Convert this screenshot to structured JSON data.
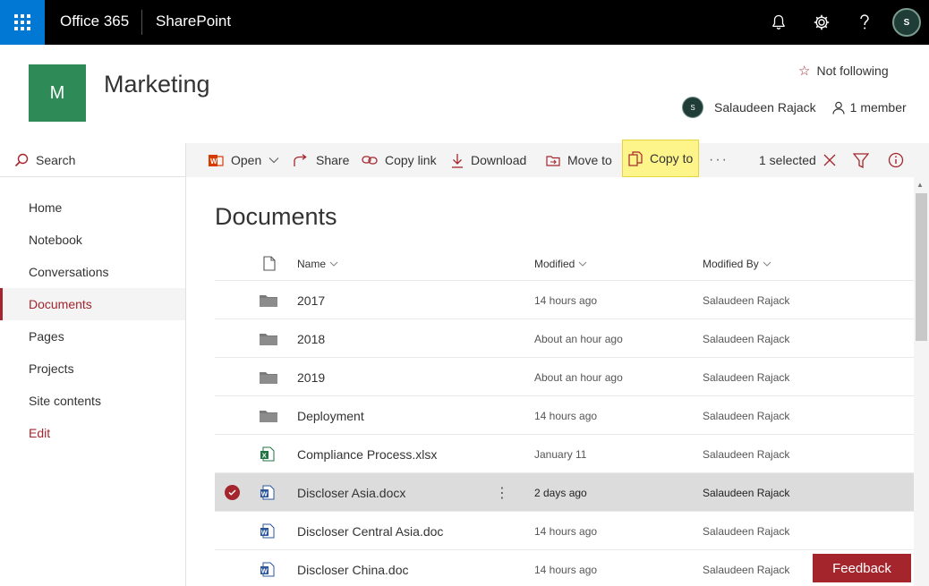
{
  "suitebar": {
    "app_name": "Office 365",
    "product": "SharePoint",
    "icons": [
      "waffle-icon",
      "bell-icon",
      "gear-icon",
      "help-icon"
    ],
    "avatar_text": "S"
  },
  "site": {
    "logo_letter": "M",
    "title": "Marketing",
    "follow_label": "Not following",
    "owner_name": "Salaudeen Rajack",
    "members_label": "1 member"
  },
  "nav": {
    "search_label": "Search",
    "items": [
      "Home",
      "Notebook",
      "Conversations",
      "Documents",
      "Pages",
      "Projects",
      "Site contents"
    ],
    "selected": "Documents",
    "edit_label": "Edit"
  },
  "commandbar": {
    "open": "Open",
    "share": "Share",
    "copy_link": "Copy link",
    "download": "Download",
    "move_to": "Move to",
    "copy_to": "Copy to",
    "more": "···",
    "selected_count": "1 selected"
  },
  "library": {
    "title": "Documents",
    "columns": {
      "name": "Name",
      "modified": "Modified",
      "modified_by": "Modified By"
    },
    "rows": [
      {
        "type": "folder",
        "name": "2017",
        "modified": "14 hours ago",
        "modified_by": "Salaudeen Rajack"
      },
      {
        "type": "folder",
        "name": "2018",
        "modified": "About an hour ago",
        "modified_by": "Salaudeen Rajack"
      },
      {
        "type": "folder",
        "name": "2019",
        "modified": "About an hour ago",
        "modified_by": "Salaudeen Rajack"
      },
      {
        "type": "folder",
        "name": "Deployment",
        "modified": "14 hours ago",
        "modified_by": "Salaudeen Rajack"
      },
      {
        "type": "excel",
        "name": "Compliance Process.xlsx",
        "modified": "January 11",
        "modified_by": "Salaudeen Rajack"
      },
      {
        "type": "word",
        "name": "Discloser Asia.docx",
        "modified": "2 days ago",
        "modified_by": "Salaudeen Rajack",
        "selected": true
      },
      {
        "type": "word",
        "name": "Discloser Central Asia.doc",
        "modified": "14 hours ago",
        "modified_by": "Salaudeen Rajack"
      },
      {
        "type": "word",
        "name": "Discloser China.doc",
        "modified": "14 hours ago",
        "modified_by": "Salaudeen Rajack"
      }
    ]
  },
  "feedback_label": "Feedback",
  "colors": {
    "accent": "#a4262c",
    "waffle": "#0078d4",
    "site_logo": "#2e8b57",
    "highlight": "#fdf48a"
  }
}
